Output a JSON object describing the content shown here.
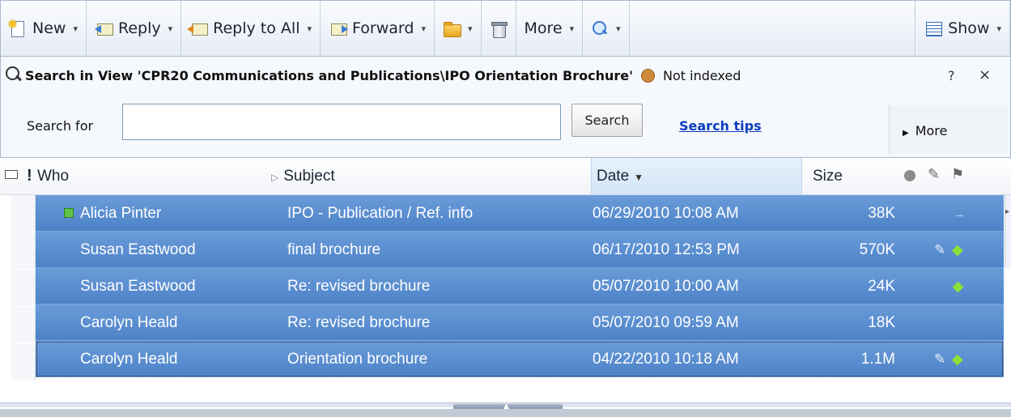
{
  "toolbar": {
    "new_label": "New",
    "reply_label": "Reply",
    "reply_all_label": "Reply to All",
    "forward_label": "Forward",
    "more_label": "More",
    "show_label": "Show"
  },
  "search": {
    "title": "Search in View 'CPR20 Communications and Publications\\IPO Orientation Brochure'",
    "index_status": "Not indexed",
    "help": "?",
    "close": "×",
    "search_for_label": "Search for",
    "input_value": "",
    "button_label": "Search",
    "tips_link": "Search tips",
    "more_label": "More"
  },
  "columns": {
    "who": "Who",
    "subject": "Subject",
    "date": "Date",
    "size": "Size"
  },
  "messages": [
    {
      "who": "Alicia Pinter",
      "subject": "IPO - Publication / Ref. info",
      "date": "06/29/2010 10:08 AM",
      "size": "38K",
      "unread": true,
      "attachment": false,
      "status_icon": "forwarded-arrow-icon"
    },
    {
      "who": "Susan Eastwood",
      "subject": "final brochure",
      "date": "06/17/2010 12:53 PM",
      "size": "570K",
      "unread": false,
      "attachment": true,
      "status_icon": "replied-arrow-icon"
    },
    {
      "who": "Susan Eastwood",
      "subject": "Re: revised brochure",
      "date": "05/07/2010 10:00 AM",
      "size": "24K",
      "unread": false,
      "attachment": false,
      "status_icon": "replied-arrow-icon"
    },
    {
      "who": "Carolyn Heald",
      "subject": "Re: revised brochure",
      "date": "05/07/2010 09:59 AM",
      "size": "18K",
      "unread": false,
      "attachment": false,
      "status_icon": ""
    },
    {
      "who": "Carolyn Heald",
      "subject": "Orientation brochure",
      "date": "04/22/2010 10:18 AM",
      "size": "1.1M",
      "unread": false,
      "attachment": true,
      "status_icon": "replied-arrow-icon"
    }
  ],
  "colors": {
    "selection": "#5a8ed0",
    "toolbar_bg": "#e6ecf5",
    "link": "#0b3dbf",
    "index_dot": "#d08a3c",
    "unread_marker": "#5ec54a"
  }
}
